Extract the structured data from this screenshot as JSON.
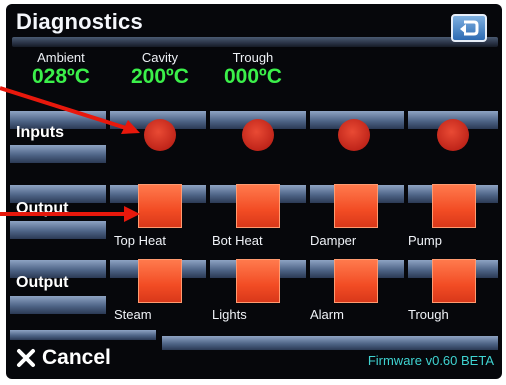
{
  "title": "Diagnostics",
  "temps": [
    {
      "label": "Ambient",
      "value": "028ºC"
    },
    {
      "label": "Cavity",
      "value": "200ºC"
    },
    {
      "label": "Trough",
      "value": "000ºC"
    }
  ],
  "rows": {
    "inputs_label": "Inputs",
    "output1_label": "Output",
    "output2_label": "Output"
  },
  "outputs1": [
    "Top Heat",
    "Bot Heat",
    "Damper",
    "Pump"
  ],
  "outputs2": [
    "Steam",
    "Lights",
    "Alarm",
    "Trough"
  ],
  "footer": {
    "cancel_label": "Cancel",
    "firmware": "Firmware v0.60 BETA"
  },
  "colors": {
    "background": "#06070b",
    "temp_value": "#3bf04a",
    "switch": "#f24c24",
    "led": "#c0251a",
    "firmware_text": "#3fd3d1",
    "annotation_arrow": "#e8180c"
  },
  "icons": {
    "back": "back-arrow-icon",
    "cancel": "close-x-icon"
  }
}
